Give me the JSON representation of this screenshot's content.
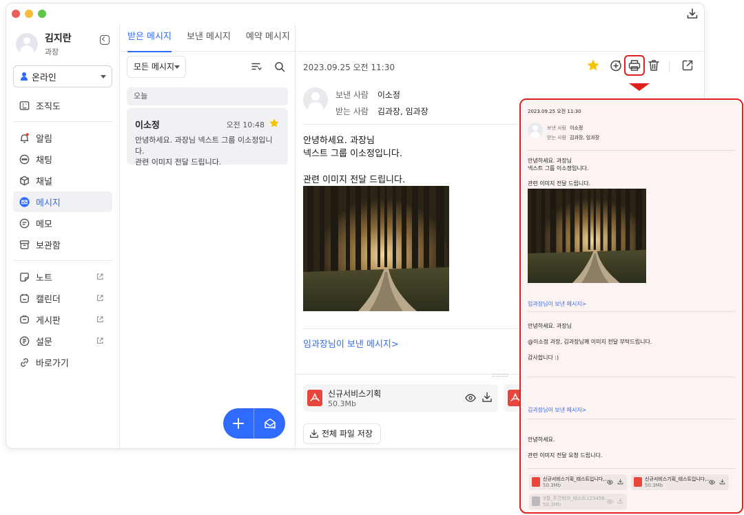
{
  "user": {
    "name": "김지란",
    "role": "과장",
    "status": "온라인"
  },
  "sidebar": {
    "items": [
      {
        "label": "조직도",
        "icon": "org-chart-icon"
      },
      {
        "label": "알림",
        "icon": "bell-icon"
      },
      {
        "label": "채팅",
        "icon": "chat-icon"
      },
      {
        "label": "채널",
        "icon": "channel-cube-icon"
      },
      {
        "label": "메시지",
        "icon": "envelope-icon",
        "active": true
      },
      {
        "label": "메모",
        "icon": "memo-icon"
      },
      {
        "label": "보관함",
        "icon": "archive-icon"
      },
      {
        "label": "노트",
        "icon": "note-icon",
        "external": true
      },
      {
        "label": "캘린더",
        "icon": "calendar-icon",
        "external": true
      },
      {
        "label": "게시판",
        "icon": "board-icon",
        "external": true
      },
      {
        "label": "설문",
        "icon": "survey-icon",
        "external": true
      },
      {
        "label": "바로가기",
        "icon": "link-icon"
      }
    ]
  },
  "tabs": [
    {
      "label": "받은 메시지",
      "active": true
    },
    {
      "label": "보낸 메시지"
    },
    {
      "label": "예약 메시지"
    }
  ],
  "list": {
    "filter": "모든 메시지",
    "group_label": "오늘",
    "items": [
      {
        "from": "이소정",
        "time": "오전 10:48",
        "starred": true,
        "preview_line1": "안녕하세요. 과장님 넥스트 그룹 이소정입니다.",
        "preview_line2": "관련 이미지 전달 드립니다."
      }
    ]
  },
  "message": {
    "datetime": "2023.09.25 오전 11:30",
    "sender_label": "보낸 사람",
    "sender": "이소정",
    "recipient_label": "받는 사람",
    "recipients": "김과장, 임과장",
    "body_line1": "안녕하세요. 과장님",
    "body_line2": "넥스트 그룹 이소정입니다.",
    "body_line3": "관련 이미지 전달 드립니다.",
    "thread_link": "임과장님이 보낸 메시지>",
    "attachment": {
      "name": "신규서비스기획",
      "size": "50.3Mb"
    },
    "save_all_label": "전체 파일 저장",
    "save_all_count": "2"
  },
  "preview": {
    "datetime": "2023.09.25 오전 11:30",
    "sender_label": "보낸 사람",
    "sender": "이소정",
    "recipient_label": "받는 사람",
    "recipients": "김과장, 임과장",
    "body_line1": "안녕하세요. 과장님",
    "body_line2": "넥스트 그룹 이소정입니다.",
    "body_line3": "관련 이미지 전달 드립니다.",
    "thread1_link": "임과장님이 보낸 메시지>",
    "thread1_line1": "안녕하세요. 과장님",
    "thread1_line2": "@이소정 과장, 김과장님께 이미지 전달 부탁드립니다.",
    "thread1_line3": "감사합니다 :)",
    "thread2_link": "김과장님이 보낸 메시지>",
    "thread2_line1": "안녕하세요.",
    "thread2_line2": "관련 이미지 전달 요청 드립니다.",
    "files": [
      {
        "name": "신규서비스기획_테스트입니다,...",
        "size": "50.3Mb"
      },
      {
        "name": "신규서비스기획_테스트입니다,...",
        "size": "50.3Mb"
      },
      {
        "name": "3월_주간회의_테스트123456...",
        "size": "50.3Mb"
      }
    ]
  },
  "colors": {
    "accent": "#2f6bff",
    "highlight": "#e0201e",
    "star": "#f5c400",
    "pdf": "#e8453c"
  }
}
